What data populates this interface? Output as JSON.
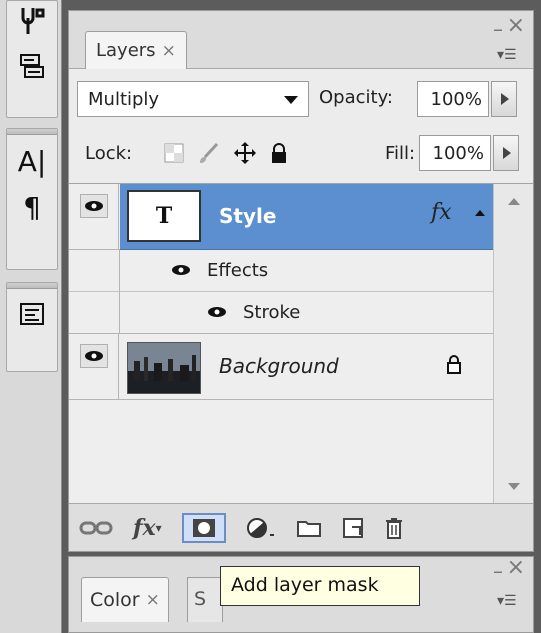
{
  "layers_panel": {
    "tab_label": "Layers",
    "blend_mode": "Multiply",
    "opacity_label": "Opacity:",
    "opacity_value": "100%",
    "lock_label": "Lock:",
    "fill_label": "Fill:",
    "fill_value": "100%",
    "layers": [
      {
        "name": "Style",
        "selected": true,
        "fx": "fx",
        "thumb_glyph": "T"
      },
      {
        "name": "Effects",
        "sub": true
      },
      {
        "name": "Stroke",
        "sub": true
      },
      {
        "name": "Background",
        "locked": true
      }
    ]
  },
  "color_panel": {
    "tab_label": "Color",
    "second_tab_initial": "S"
  },
  "tooltip": {
    "text": "Add layer mask"
  },
  "bottom_bar_icons": [
    "link-layers-icon",
    "fx-icon",
    "layer-mask-icon",
    "adjustment-layer-icon",
    "group-folder-icon",
    "new-layer-icon",
    "trash-icon"
  ]
}
